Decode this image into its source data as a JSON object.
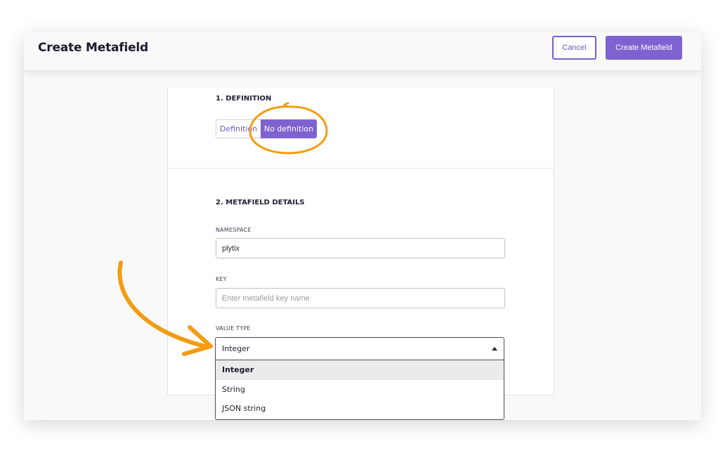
{
  "header": {
    "title": "Create Metafield",
    "cancel_label": "Cancel",
    "create_label": "Create Metafield"
  },
  "definition": {
    "section_title": "1. DEFINITION",
    "options": [
      "Definition",
      "No definition"
    ],
    "selected": "No definition"
  },
  "details": {
    "section_title": "2. METAFIELD DETAILS",
    "namespace": {
      "label": "NAMESPACE",
      "value": "plytix"
    },
    "key": {
      "label": "KEY",
      "value": "",
      "placeholder": "Enter metafield key name"
    },
    "value_type": {
      "label": "VALUE TYPE",
      "selected": "Integer",
      "options": [
        "Integer",
        "String",
        "JSON string"
      ]
    }
  },
  "annotations": {
    "color": "#f39c12"
  },
  "colors": {
    "accent": "#7e62cf",
    "accent_text": "#6f51c4"
  }
}
